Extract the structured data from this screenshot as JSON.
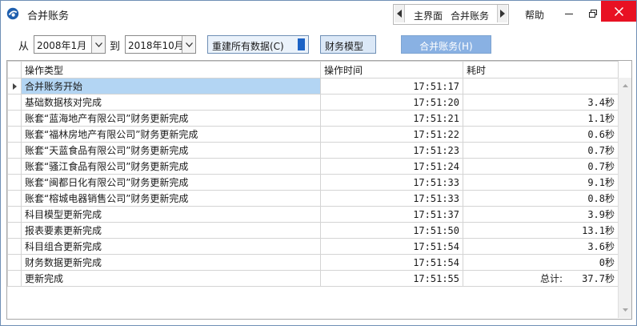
{
  "window": {
    "title": "合并账务",
    "icon": "app-logo-icon"
  },
  "nav": {
    "main": "主界面",
    "current": "合并账务"
  },
  "help": "帮助",
  "toolbar": {
    "from_label": "从",
    "from_value": "2008年1月",
    "to_label": "到",
    "to_value": "2018年10月",
    "rebuild_label": "重建所有数据(C)",
    "finance_model_label": "财务模型",
    "merge_label": "合并账务(H)"
  },
  "table": {
    "columns": [
      "操作类型",
      "操作时间",
      "耗时"
    ],
    "rows": [
      {
        "op": "合并账务开始",
        "time": "17:51:17",
        "dur": ""
      },
      {
        "op": "基础数据核对完成",
        "time": "17:51:20",
        "dur": "3.4秒"
      },
      {
        "op": "账套“蓝海地产有限公司”财务更新完成",
        "time": "17:51:21",
        "dur": "1.1秒"
      },
      {
        "op": "账套“福林房地产有限公司”财务更新完成",
        "time": "17:51:22",
        "dur": "0.6秒"
      },
      {
        "op": "账套“天蓝食品有限公司”财务更新完成",
        "time": "17:51:23",
        "dur": "0.7秒"
      },
      {
        "op": "账套“骚江食品有限公司”财务更新完成",
        "time": "17:51:24",
        "dur": "0.7秒"
      },
      {
        "op": "账套“闽都日化有限公司”财务更新完成",
        "time": "17:51:33",
        "dur": "9.1秒"
      },
      {
        "op": "账套“榕城电器销售公司”财务更新完成",
        "time": "17:51:33",
        "dur": "0.8秒"
      },
      {
        "op": "科目模型更新完成",
        "time": "17:51:37",
        "dur": "3.9秒"
      },
      {
        "op": "报表要素更新完成",
        "time": "17:51:50",
        "dur": "13.1秒"
      },
      {
        "op": "科目组合更新完成",
        "time": "17:51:54",
        "dur": "3.6秒"
      },
      {
        "op": "财务数据更新完成",
        "time": "17:51:54",
        "dur": "0秒"
      },
      {
        "op": "更新完成",
        "time": "17:51:55",
        "dur": "37.7秒",
        "total_label": "总计:"
      }
    ]
  },
  "colors": {
    "selected_row": "#b3d5f3",
    "merge_button": "#89b1e3",
    "rebuild_indicator": "#1c63c6",
    "close_button": "#e81123"
  }
}
